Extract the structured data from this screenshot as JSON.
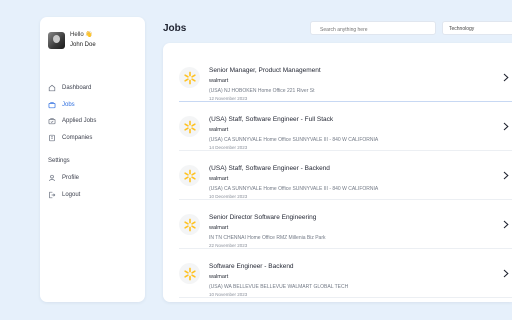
{
  "user": {
    "greeting": "Hello 👋",
    "name": "John Doe"
  },
  "nav": {
    "items": [
      {
        "label": "Dashboard",
        "icon": "home-icon"
      },
      {
        "label": "Jobs",
        "icon": "briefcase-icon",
        "active": true
      },
      {
        "label": "Applied Jobs",
        "icon": "briefcase-check-icon"
      },
      {
        "label": "Companies",
        "icon": "building-icon"
      }
    ],
    "settings_label": "Settings",
    "settings_items": [
      {
        "label": "Profile",
        "icon": "user-icon"
      },
      {
        "label": "Logout",
        "icon": "logout-icon"
      }
    ]
  },
  "header": {
    "title": "Jobs",
    "search_placeholder": "Search anything here",
    "filter_value": "Technology"
  },
  "colors": {
    "accent": "#2f6fe0",
    "walmart_yellow": "#ffc220",
    "background": "#e6f0fb"
  },
  "jobs": [
    {
      "title": "Senior Manager, Product Management",
      "company": "walmart",
      "location": "(USA) NJ HOBOKEN Home Office 221 River St",
      "date": "12 November 2023"
    },
    {
      "title": "(USA) Staff, Software Engineer - Full Stack",
      "company": "walmart",
      "location": "(USA) CA SUNNYVALE Home Office SUNNYVALE III - 840 W CALIFORNIA",
      "date": "14 December 2023"
    },
    {
      "title": "(USA) Staff, Software Engineer - Backend",
      "company": "walmart",
      "location": "(USA) CA SUNNYVALE Home Office SUNNYVALE III - 840 W CALIFORNIA",
      "date": "10 December 2023"
    },
    {
      "title": "Senior Director Software Engineering",
      "company": "walmart",
      "location": "IN TN CHENNAI Home Office RMZ Millenia Biz Park",
      "date": "22 November 2023"
    },
    {
      "title": "Software Engineer - Backend",
      "company": "walmart",
      "location": "(USA) WA BELLEVUE BELLEVUE WALMART GLOBAL TECH",
      "date": "10 November 2023"
    }
  ]
}
